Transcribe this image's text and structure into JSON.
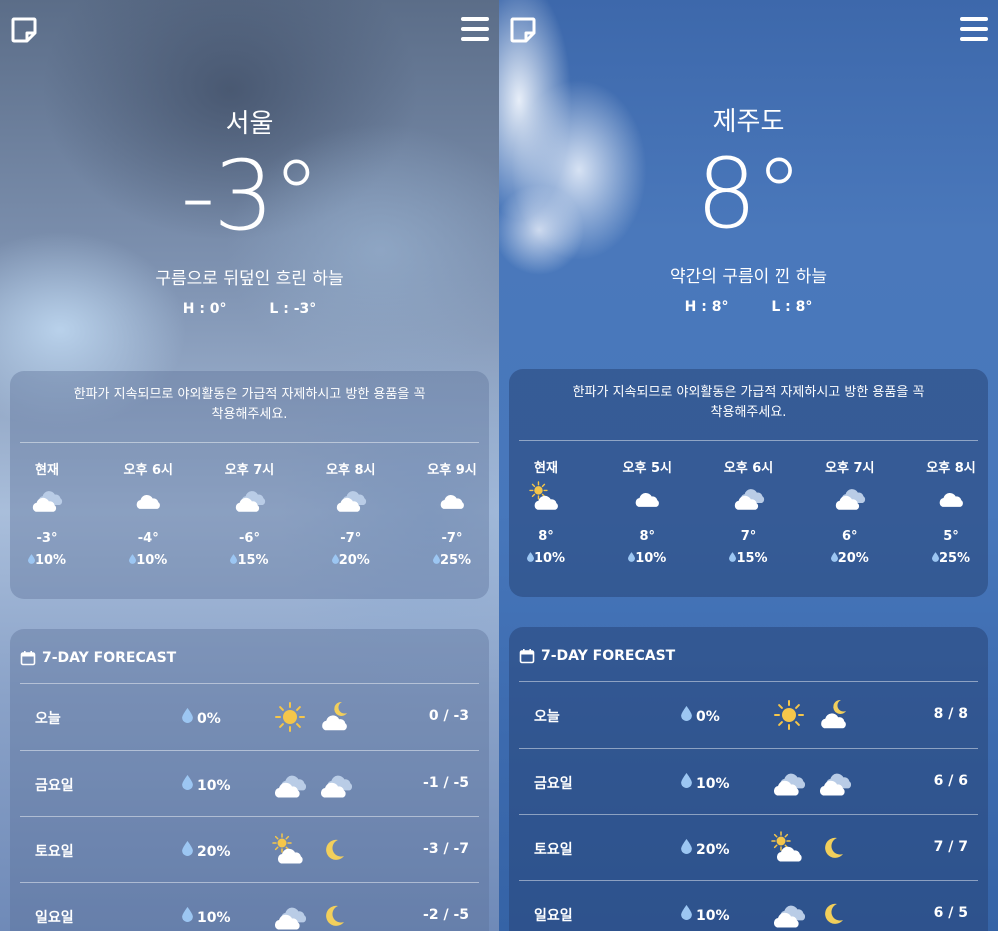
{
  "panels": [
    {
      "city": "서울",
      "temp": "-3°",
      "condition": "구름으로 뒤덮인 흐린 하늘",
      "high": "H : 0°",
      "low": "L : -3°",
      "notice": "한파가 지속되므로 야외활동은 가급적 자제하시고 방한 용품을 꼭 착용해주세요.",
      "hourly": [
        {
          "label": "현재",
          "icon": "cloudy-icon",
          "temp": "-3°",
          "pop": "10%"
        },
        {
          "label": "오후 6시",
          "icon": "cloud-icon",
          "temp": "-4°",
          "pop": "10%"
        },
        {
          "label": "오후 7시",
          "icon": "cloudy-icon",
          "temp": "-6°",
          "pop": "15%"
        },
        {
          "label": "오후 8시",
          "icon": "cloudy-icon",
          "temp": "-7°",
          "pop": "20%"
        },
        {
          "label": "오후 9시",
          "icon": "cloud-icon",
          "temp": "-7°",
          "pop": "25%"
        }
      ],
      "forecast_title": "7-DAY FORECAST",
      "forecast": [
        {
          "day": "오늘",
          "pop": "0%",
          "icon1": "sun-icon",
          "icon2": "moon-cloud-icon",
          "temp": "0 / -3"
        },
        {
          "day": "금요일",
          "pop": "10%",
          "icon1": "cloudy-icon",
          "icon2": "cloudy-icon",
          "temp": "-1 / -5"
        },
        {
          "day": "토요일",
          "pop": "20%",
          "icon1": "sun-cloud-icon",
          "icon2": "moon-icon",
          "temp": "-3 / -7"
        },
        {
          "day": "일요일",
          "pop": "10%",
          "icon1": "cloudy-icon",
          "icon2": "moon-icon",
          "temp": "-2 / -5"
        }
      ]
    },
    {
      "city": "제주도",
      "temp": "8°",
      "condition": "약간의 구름이 낀 하늘",
      "high": "H : 8°",
      "low": "L : 8°",
      "notice": "한파가 지속되므로 야외활동은 가급적 자제하시고 방한 용품을 꼭 착용해주세요.",
      "hourly": [
        {
          "label": "현재",
          "icon": "sun-cloud-icon",
          "temp": "8°",
          "pop": "10%"
        },
        {
          "label": "오후 5시",
          "icon": "cloud-icon",
          "temp": "8°",
          "pop": "10%"
        },
        {
          "label": "오후 6시",
          "icon": "cloudy-icon",
          "temp": "7°",
          "pop": "15%"
        },
        {
          "label": "오후 7시",
          "icon": "cloudy-icon",
          "temp": "6°",
          "pop": "20%"
        },
        {
          "label": "오후 8시",
          "icon": "cloud-icon",
          "temp": "5°",
          "pop": "25%"
        }
      ],
      "forecast_title": "7-DAY FORECAST",
      "forecast": [
        {
          "day": "오늘",
          "pop": "0%",
          "icon1": "sun-icon",
          "icon2": "moon-cloud-icon",
          "temp": "8 / 8"
        },
        {
          "day": "금요일",
          "pop": "10%",
          "icon1": "cloudy-icon",
          "icon2": "cloudy-icon",
          "temp": "6 / 6"
        },
        {
          "day": "토요일",
          "pop": "20%",
          "icon1": "sun-cloud-icon",
          "icon2": "moon-icon",
          "temp": "7 / 7"
        },
        {
          "day": "일요일",
          "pop": "10%",
          "icon1": "cloudy-icon",
          "icon2": "moon-icon",
          "temp": "6 / 5"
        }
      ]
    }
  ],
  "colors": {
    "sun": "#f5c64a",
    "moon": "#f2cf5b",
    "cloud": "#ffffff",
    "cloud_shade": "#b9cce6",
    "drop": "#9cc6f2"
  }
}
